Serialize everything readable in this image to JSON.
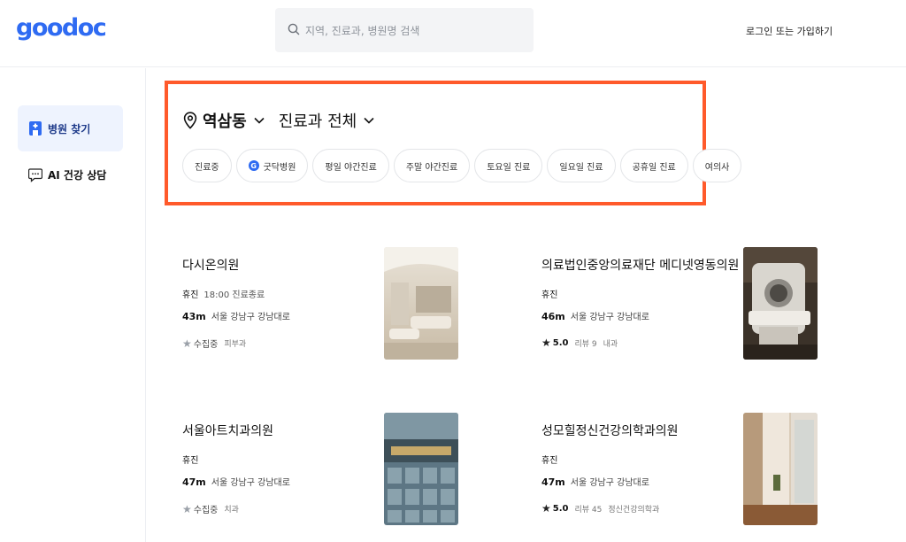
{
  "brand": {
    "logo": "goodoc",
    "accent": "#2f6bf2"
  },
  "search": {
    "placeholder": "지역, 진료과, 병원명 검색"
  },
  "header": {
    "login_label": "로그인 또는 가입하기"
  },
  "sidebar": {
    "items": [
      {
        "label": "병원 찾기",
        "icon": "hospital-icon",
        "active": true
      },
      {
        "label": "AI 건강 상담",
        "icon": "chat-icon",
        "active": false
      }
    ]
  },
  "filter": {
    "location": "역삼동",
    "department": "진료과 전체",
    "highlight_color": "#ff5a2b",
    "chips": [
      {
        "label": "진료중"
      },
      {
        "label": "굿닥병원",
        "badge": "G"
      },
      {
        "label": "평일 야간진료"
      },
      {
        "label": "주말 야간진료"
      },
      {
        "label": "토요일 진료"
      },
      {
        "label": "일요일 진료"
      },
      {
        "label": "공휴일 진료"
      },
      {
        "label": "여의사"
      }
    ]
  },
  "hospitals": [
    {
      "name": "다시온의원",
      "status": "휴진",
      "hours": "18:00 진료종료",
      "distance": "43m",
      "address": "서울 강남구 강남대로",
      "rating_text": "수집중",
      "department": "피부과",
      "image": "clinic-lobby-photo"
    },
    {
      "name": "의료법인중앙의료재단 메디넷영동의원",
      "status": "휴진",
      "hours": "",
      "distance": "46m",
      "address": "서울 강남구 강남대로",
      "rating": "5.0",
      "reviews": "리뷰 9",
      "department": "내과",
      "image": "mri-room-photo"
    },
    {
      "name": "서울아트치과의원",
      "status": "휴진",
      "hours": "",
      "distance": "47m",
      "address": "서울 강남구 강남대로",
      "rating_text": "수집중",
      "department": "치과",
      "image": "building-exterior-photo"
    },
    {
      "name": "성모힐정신건강의학과의원",
      "status": "휴진",
      "hours": "",
      "distance": "47m",
      "address": "서울 강남구 강남대로",
      "rating": "5.0",
      "reviews": "리뷰 45",
      "department": "정신건강의학과",
      "image": "hallway-photo"
    }
  ]
}
